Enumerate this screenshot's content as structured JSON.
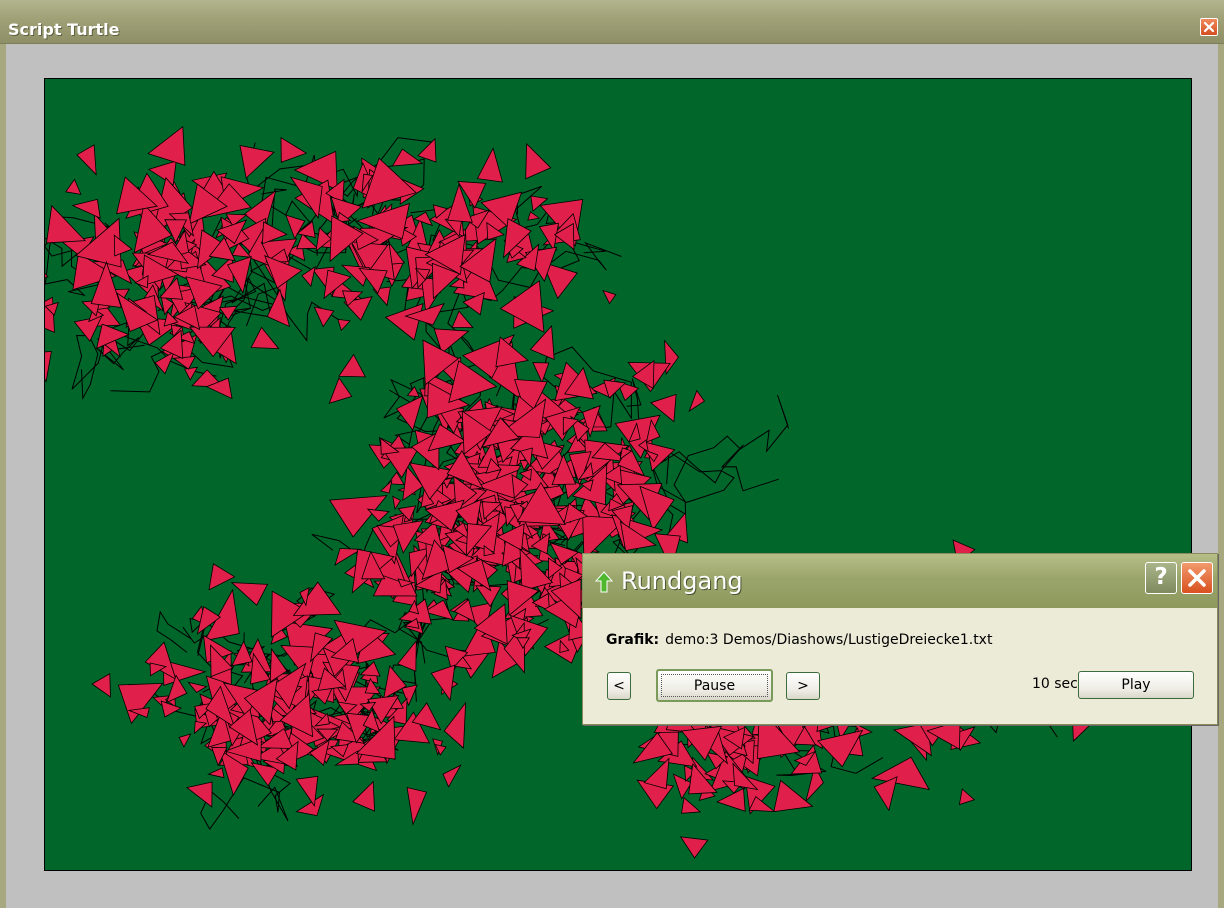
{
  "window": {
    "title": "Script Turtle"
  },
  "canvas": {
    "background_color": "#00662a",
    "triangle_color": "#e0204a",
    "line_color": "#000000"
  },
  "dialog": {
    "title": "Rundgang",
    "help_label": "?",
    "grafik_label": "Grafik:",
    "grafik_value": "demo:3 Demos/Diashows/LustigeDreiecke1.txt",
    "prev_label": "<",
    "pause_label": "Pause",
    "next_label": ">",
    "interval_text": "10 sec",
    "play_label": "Play"
  },
  "icons": {
    "window_close": "close-icon",
    "dialog_title_icon": "up-arrow-icon",
    "dialog_help": "help-icon",
    "dialog_close": "close-icon"
  }
}
